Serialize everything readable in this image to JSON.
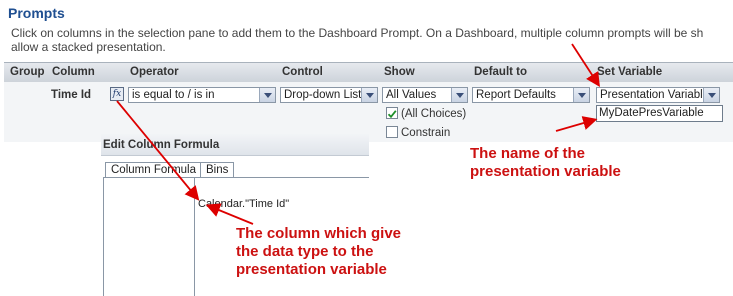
{
  "header": {
    "title": "Prompts",
    "description_line1": "Click on columns in the selection pane to add them to the Dashboard Prompt. On a Dashboard, multiple column prompts will be sh",
    "description_line2": "allow a stacked presentation."
  },
  "table": {
    "columns": [
      "Group",
      "Column",
      "Operator",
      "Control",
      "Show",
      "Default to",
      "Set Variable"
    ],
    "row": {
      "column_name": "Time Id",
      "fx_label": "fx",
      "operator": "is equal to / is in",
      "control": "Drop-down List",
      "show": "All Values",
      "default_to": "Report Defaults",
      "set_variable": "Presentation Variable",
      "variable_name": "MyDatePresVariable",
      "all_choices_label": "(All Choices)",
      "all_choices_checked": true,
      "constrain_label": "Constrain",
      "constrain_checked": false
    }
  },
  "formula_panel": {
    "title": "Edit Column Formula",
    "tabs": [
      "Column Formula",
      "Bins"
    ],
    "active_tab": "Column Formula",
    "formula": "Calendar.\"Time Id\""
  },
  "annotations": {
    "variable_note_line1": "The name of the",
    "variable_note_line2": "presentation variable",
    "column_note_line1": "The column which give",
    "column_note_line2": "the data type to the",
    "column_note_line3": "presentation variable",
    "arrow_color": "#dd0000"
  },
  "icons": {
    "dropdown": "chevron-down-icon",
    "formula": "fx-icon",
    "checkbox_checked": "check-icon"
  }
}
